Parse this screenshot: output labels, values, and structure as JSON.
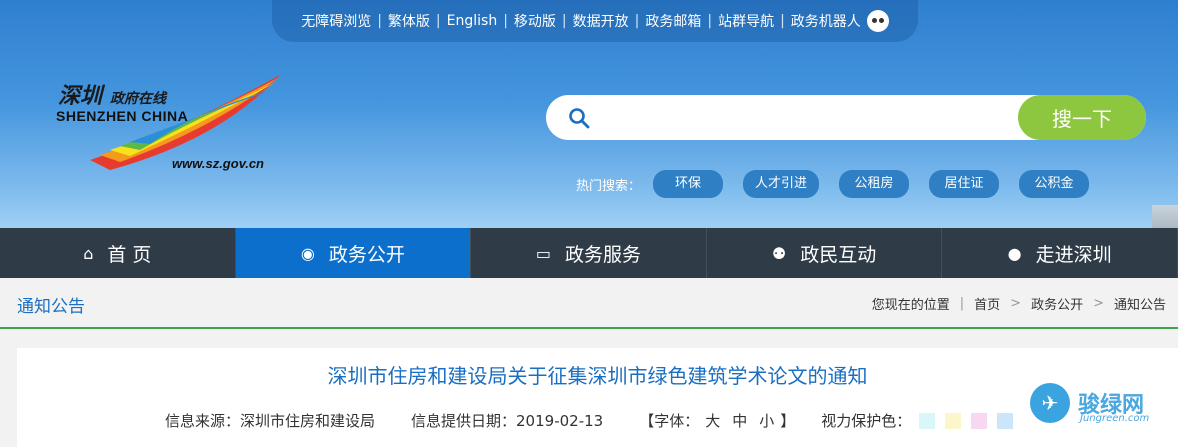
{
  "topbar": {
    "links": [
      "无障碍浏览",
      "繁体版",
      "English",
      "移动版",
      "数据开放",
      "政务邮箱",
      "站群导航",
      "政务机器人"
    ]
  },
  "logo": {
    "cn_main": "深圳",
    "cn_sub": "政府在线",
    "en": "SHENZHEN CHINA",
    "url": "www.sz.gov.cn"
  },
  "search": {
    "placeholder": "",
    "button": "搜一下"
  },
  "hot": {
    "label": "热门搜索：",
    "tags": [
      "环保",
      "人才引进",
      "公租房",
      "居住证",
      "公积金"
    ]
  },
  "nav": {
    "items": [
      {
        "label": "首 页",
        "icon": "home-icon",
        "glyph": "⌂"
      },
      {
        "label": "政务公开",
        "icon": "news-icon",
        "glyph": "◉"
      },
      {
        "label": "政务服务",
        "icon": "monitor-icon",
        "glyph": "▭"
      },
      {
        "label": "政民互动",
        "icon": "people-icon",
        "glyph": "⚉"
      },
      {
        "label": "走进深圳",
        "icon": "chat-icon",
        "glyph": "●"
      }
    ],
    "active_index": 1
  },
  "section": {
    "title": "通知公告",
    "crumbs": {
      "prefix": "您现在的位置",
      "path": [
        "首页",
        "政务公开",
        "通知公告"
      ]
    }
  },
  "article": {
    "title": "深圳市住房和建设局关于征集深圳市绿色建筑学术论文的通知",
    "source": "信息来源：深圳市住房和建设局",
    "date": "信息提供日期：2019-02-13",
    "font_label_open": "【字体：",
    "font_sizes": [
      "大",
      "中",
      "小"
    ],
    "font_label_close": "】",
    "eye_label": "视力保护色：",
    "eye_colors": [
      "#d9f7fb",
      "#fbf7c8",
      "#f7d8f0",
      "#cde5fb"
    ]
  },
  "watermark": {
    "text": "骏绿网",
    "url": "Jungreen.com"
  }
}
